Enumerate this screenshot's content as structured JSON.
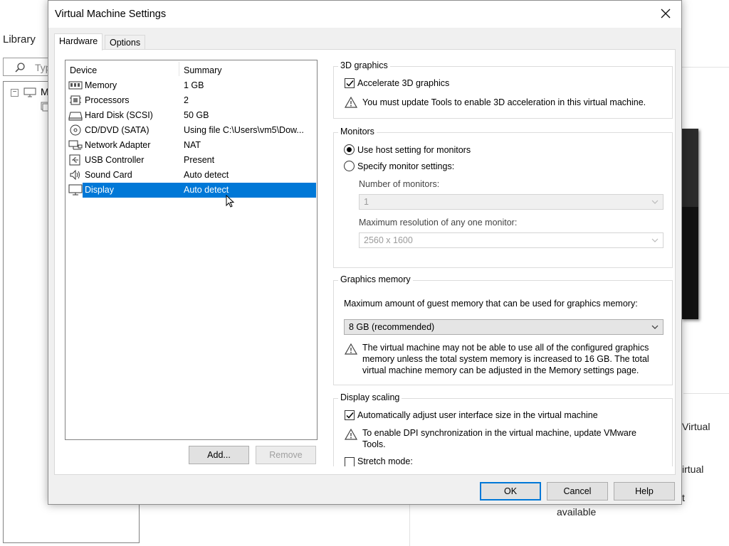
{
  "background": {
    "library_label": "Library",
    "search_placeholder": "Typ",
    "tree_item": "M",
    "text_virtual1": "Virtual",
    "text_virtual2": "irtual",
    "text_t": "t",
    "text_available": "available"
  },
  "dialog": {
    "title": "Virtual Machine Settings",
    "tabs": {
      "hardware": "Hardware",
      "options": "Options"
    },
    "device_list": {
      "col_device": "Device",
      "col_summary": "Summary",
      "rows": [
        {
          "device": "Memory",
          "summary": "1 GB",
          "icon": "memory-icon"
        },
        {
          "device": "Processors",
          "summary": "2",
          "icon": "processor-icon"
        },
        {
          "device": "Hard Disk (SCSI)",
          "summary": "50 GB",
          "icon": "hard-disk-icon"
        },
        {
          "device": "CD/DVD (SATA)",
          "summary": "Using file C:\\Users\\vm5\\Dow...",
          "icon": "cd-dvd-icon"
        },
        {
          "device": "Network Adapter",
          "summary": "NAT",
          "icon": "network-adapter-icon"
        },
        {
          "device": "USB Controller",
          "summary": "Present",
          "icon": "usb-icon"
        },
        {
          "device": "Sound Card",
          "summary": "Auto detect",
          "icon": "speaker-icon"
        },
        {
          "device": "Display",
          "summary": "Auto detect",
          "icon": "monitor-icon",
          "selected": true
        }
      ]
    },
    "add_button": "Add...",
    "remove_button": "Remove",
    "graphics3d": {
      "title": "3D graphics",
      "accelerate_label": "Accelerate 3D graphics",
      "accelerate_checked": true,
      "warning": "You must update Tools to enable 3D acceleration in this virtual machine."
    },
    "monitors": {
      "title": "Monitors",
      "use_host_label": "Use host setting for monitors",
      "use_host_selected": true,
      "specify_label": "Specify monitor settings:",
      "number_label": "Number of monitors:",
      "number_value": "1",
      "max_res_label": "Maximum resolution of any one monitor:",
      "max_res_value": "2560 x 1600"
    },
    "graphics_memory": {
      "title": "Graphics memory",
      "desc": "Maximum amount of guest memory that can be used for graphics memory:",
      "value": "8 GB (recommended)",
      "warning": "The virtual machine may not be able to use all of the configured graphics memory unless the total system memory is increased to 16 GB. The total virtual machine memory can be adjusted in the Memory settings page."
    },
    "display_scaling": {
      "title": "Display scaling",
      "auto_adjust_label": "Automatically adjust user interface size in the virtual machine",
      "auto_adjust_checked": true,
      "warning": "To enable DPI synchronization in the virtual machine, update VMware Tools.",
      "stretch_label": "Stretch mode:",
      "stretch_checked": false
    },
    "ok_button": "OK",
    "cancel_button": "Cancel",
    "help_button": "Help"
  },
  "colors": {
    "selection": "#0078d7",
    "dialog_bg": "#f0f0f0"
  }
}
